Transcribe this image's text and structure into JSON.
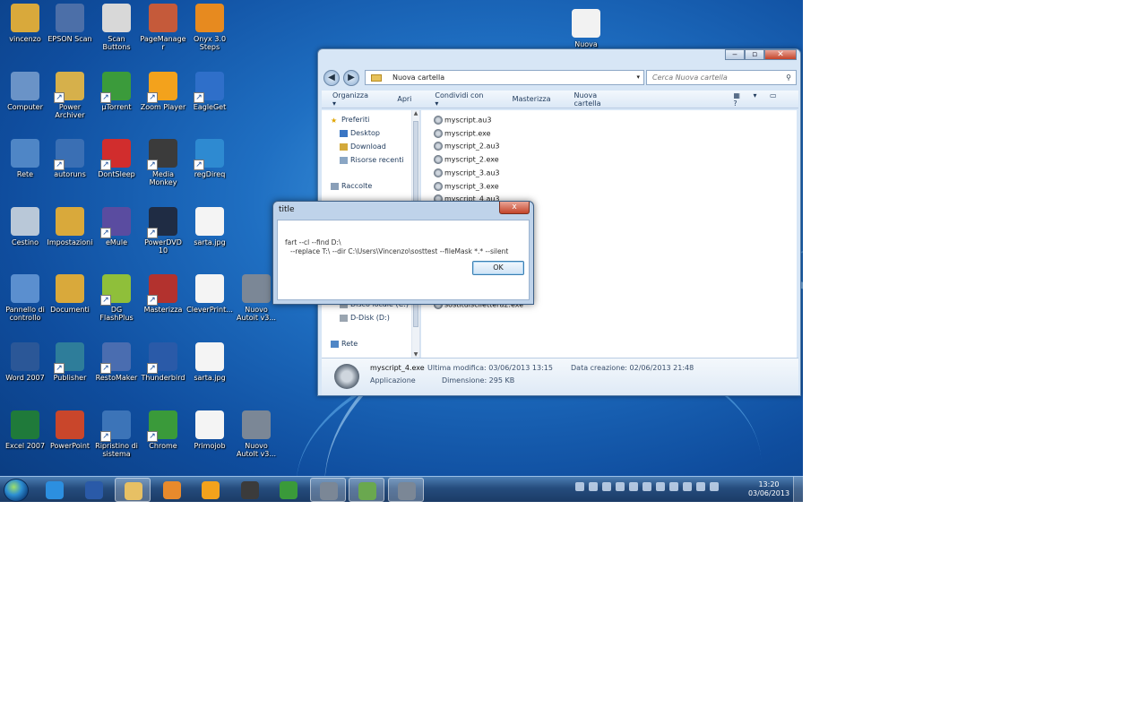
{
  "desktop": {
    "icons": [
      {
        "label": "vincenzo",
        "icon": "user-folder-icon",
        "color": "#d9a93b"
      },
      {
        "label": "EPSON Scan",
        "icon": "scanner-icon",
        "color": "#4c6fa8"
      },
      {
        "label": "Scan Buttons",
        "icon": "scan-buttons-icon",
        "color": "#d8d8d8"
      },
      {
        "label": "PageManager",
        "icon": "pagemanager-icon",
        "color": "#c55a3a"
      },
      {
        "label": "Onyx 3.0 Steps",
        "icon": "zps-icon",
        "color": "#e78a1f"
      },
      {
        "label": "Nuova",
        "icon": "new-document-icon",
        "color": "#f2f2f2"
      },
      {
        "label": "Computer",
        "icon": "computer-icon",
        "color": "#6a93c7"
      },
      {
        "label": "Power Archiver",
        "icon": "archiver-icon",
        "color": "#d6b04b"
      },
      {
        "label": "µTorrent",
        "icon": "utorrent-icon",
        "color": "#3b9b3b"
      },
      {
        "label": "Zoom Player",
        "icon": "zoom-player-icon",
        "color": "#f3a21c"
      },
      {
        "label": "EagleGet",
        "icon": "eagleget-icon",
        "color": "#2f6fc9"
      },
      {
        "label": "Rete",
        "icon": "network-icon",
        "color": "#4f86c6"
      },
      {
        "label": "autoruns",
        "icon": "autoruns-icon",
        "color": "#3a6fb4"
      },
      {
        "label": "DontSleep",
        "icon": "dontsleep-icon",
        "color": "#d12d2d"
      },
      {
        "label": "Media Monkey",
        "icon": "mediamonkey-icon",
        "color": "#3b3b3b"
      },
      {
        "label": "regDireq",
        "icon": "registry-icon",
        "color": "#2e8ad1"
      },
      {
        "label": "Cestino",
        "icon": "recycle-bin-icon",
        "color": "#b9c8d8"
      },
      {
        "label": "Impostazioni",
        "icon": "settings-folder-icon",
        "color": "#d9a93b"
      },
      {
        "label": "eMule",
        "icon": "emule-icon",
        "color": "#5a4ca0"
      },
      {
        "label": "PowerDVD 10",
        "icon": "powerdvd-icon",
        "color": "#1f2c44"
      },
      {
        "label": "sarta.jpg",
        "icon": "image-file-icon",
        "color": "#f4f4f4"
      },
      {
        "label": "Pannello di controllo",
        "icon": "control-panel-icon",
        "color": "#5b8fcf"
      },
      {
        "label": "Documenti",
        "icon": "documents-folder-icon",
        "color": "#d9a93b"
      },
      {
        "label": "DG FlashPlus",
        "icon": "flashplus-icon",
        "color": "#8fbf3a"
      },
      {
        "label": "Masterizza",
        "icon": "burn-icon",
        "color": "#b3322e"
      },
      {
        "label": "CleverPrint...",
        "icon": "blank-file-icon",
        "color": "#f4f4f4"
      },
      {
        "label": "Nuovo Autoit v3...",
        "icon": "autoit-script-icon",
        "color": "#7b8796"
      },
      {
        "label": "Word 2007",
        "icon": "word-icon",
        "color": "#2b5797"
      },
      {
        "label": "Publisher",
        "icon": "publisher-icon",
        "color": "#2e7d9a"
      },
      {
        "label": "RestoMaker",
        "icon": "restomaker-icon",
        "color": "#4a6db0"
      },
      {
        "label": "Thunderbird",
        "icon": "thunderbird-icon",
        "color": "#2a5aa8"
      },
      {
        "label": "sarta.jpg",
        "icon": "image-file-icon",
        "color": "#f4f4f4"
      },
      {
        "label": "Excel 2007",
        "icon": "excel-icon",
        "color": "#1f7a3a"
      },
      {
        "label": "PowerPoint",
        "icon": "powerpoint-icon",
        "color": "#c9462b"
      },
      {
        "label": "Ripristino di sistema",
        "icon": "system-restore-icon",
        "color": "#3c74b8"
      },
      {
        "label": "Chrome",
        "icon": "chrome-icon",
        "color": "#3a9a3a"
      },
      {
        "label": "Primojob",
        "icon": "blank-file-icon",
        "color": "#f4f4f4"
      },
      {
        "label": "Nuovo AutoIt v3...",
        "icon": "autoit-script-icon",
        "color": "#7b8796"
      }
    ]
  },
  "explorer": {
    "address": "Nuova cartella",
    "search_placeholder": "Cerca Nuova cartella",
    "toolbar": {
      "organize": "Organizza ▾",
      "open": "Apri",
      "share": "Condividi con ▾",
      "burn": "Masterizza",
      "new_folder": "Nuova cartella"
    },
    "nav": {
      "favorites": "Preferiti",
      "desktop": "Desktop",
      "download": "Download",
      "recent": "Risorse recenti",
      "libraries": "Raccolte",
      "local_disk": "Disco locale (C:)",
      "d_disk": "D-Disk (D:)",
      "network": "Rete"
    },
    "files": [
      "myscript.au3",
      "myscript.exe",
      "myscript_2.au3",
      "myscript_2.exe",
      "myscript_3.au3",
      "myscript_3.exe",
      "myscript_4.au3"
    ],
    "extra_file": "sostituiscilettera2.exe",
    "details": {
      "name": "myscript_4.exe",
      "type": "Applicazione",
      "modified": "Ultima modifica: 03/06/2013 13:15",
      "size": "Dimensione: 295 KB",
      "created": "Data creazione: 02/06/2013 21:48"
    }
  },
  "msgbox": {
    "title": "title",
    "line1": "fart --cl --find D:\\",
    "line2": "--replace T:\\ --dir C:\\Users\\Vincenzo\\sosttest --fileMask *.* --silent",
    "ok": "OK",
    "close": "x"
  },
  "taskbar": {
    "time": "13:20",
    "date": "03/06/2013",
    "buttons": [
      {
        "name": "ie",
        "color": "#2c8fe0",
        "active": false
      },
      {
        "name": "thunderbird",
        "color": "#2a5aa8",
        "active": false
      },
      {
        "name": "explorer",
        "color": "#e7c064",
        "active": true
      },
      {
        "name": "media-player",
        "color": "#e88a2c",
        "active": false
      },
      {
        "name": "zoom-player",
        "color": "#f3a21c",
        "active": false
      },
      {
        "name": "mediamonkey",
        "color": "#3b3b3b",
        "active": false
      },
      {
        "name": "chrome",
        "color": "#3a9a3a",
        "active": false
      },
      {
        "name": "autoit",
        "color": "#7b8796",
        "active": true
      },
      {
        "name": "notepad",
        "color": "#6aa84f",
        "active": true
      },
      {
        "name": "autoit-2",
        "color": "#7b8796",
        "active": true
      }
    ]
  }
}
